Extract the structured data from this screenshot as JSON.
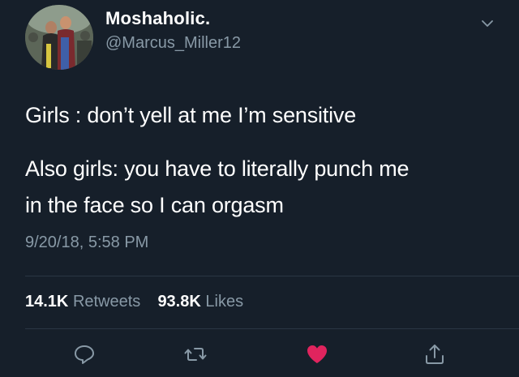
{
  "user": {
    "display_name": "Moshaholic.",
    "handle": "@Marcus_Miller12"
  },
  "tweet": {
    "lines": [
      "Girls : don’t yell at me I’m sensitive",
      "Also girls: you have to literally punch me",
      "in the face so I can orgasm"
    ],
    "timestamp": "9/20/18, 5:58 PM"
  },
  "stats": {
    "retweets_count": "14.1K",
    "retweets_label": "Retweets",
    "likes_count": "93.8K",
    "likes_label": "Likes"
  },
  "actions": {
    "reply_icon": "reply-icon",
    "retweet_icon": "retweet-icon",
    "like_icon": "heart-icon",
    "share_icon": "share-icon",
    "like_color": "#e0245e",
    "icon_color": "#8899a6"
  },
  "colors": {
    "background": "#161f2a",
    "text": "#ffffff",
    "secondary": "#8899a6"
  }
}
